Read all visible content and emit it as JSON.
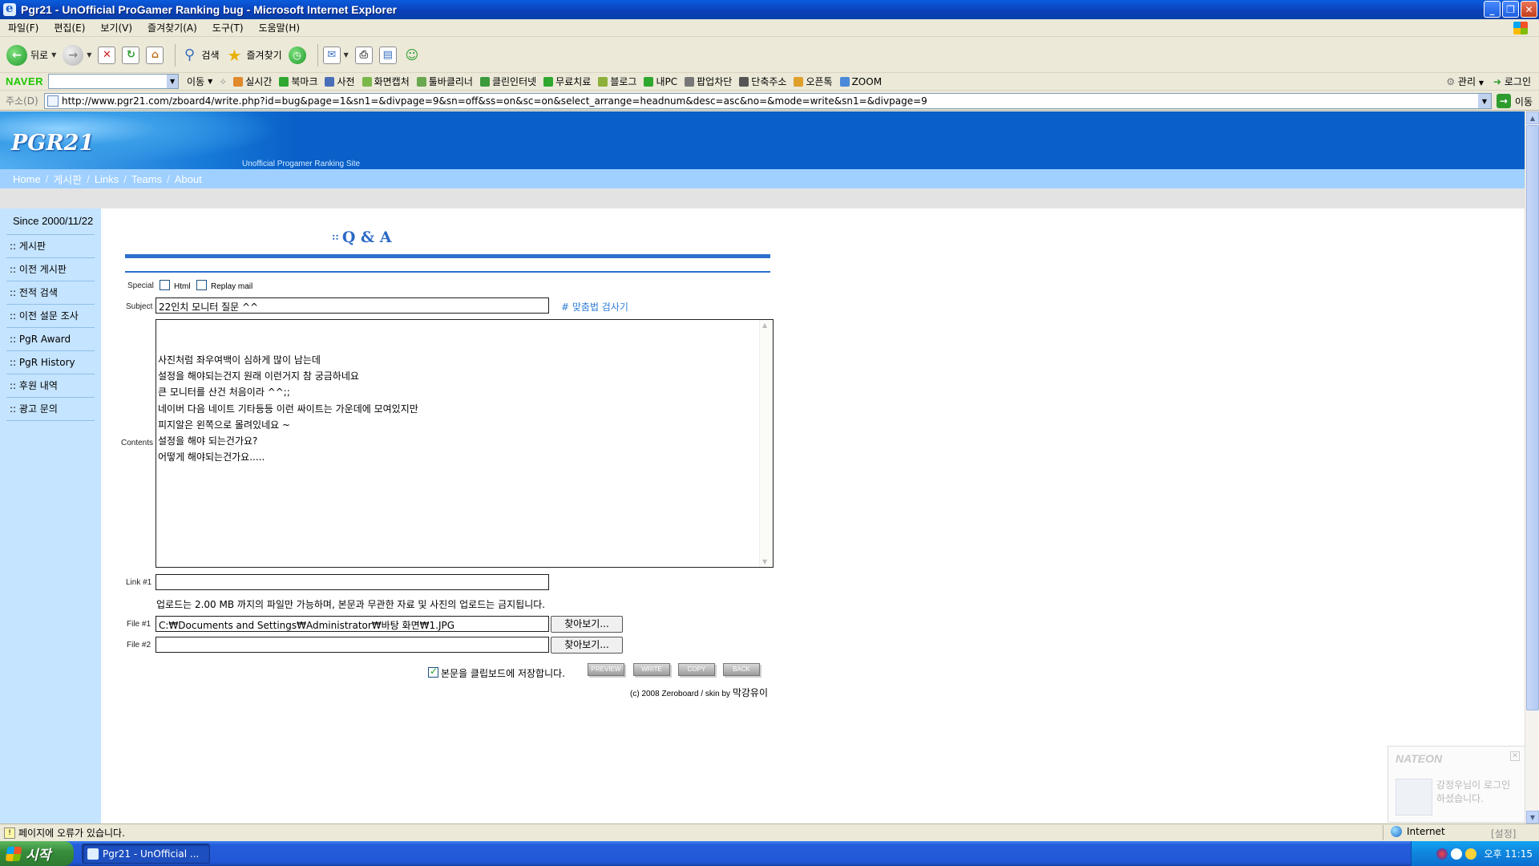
{
  "window": {
    "title": "Pgr21 - UnOfficial ProGamer Ranking bug - Microsoft Internet Explorer",
    "controls": [
      "_",
      "❐",
      "✕"
    ]
  },
  "menubar": [
    "파일(F)",
    "편집(E)",
    "보기(V)",
    "즐겨찾기(A)",
    "도구(T)",
    "도움말(H)"
  ],
  "toolbar": {
    "back": "뒤로",
    "search": "검색",
    "favorites": "즐겨찾기"
  },
  "naver_bar": {
    "logo": "NAVER",
    "search_value": "",
    "go": "이동",
    "items": [
      {
        "label": "실시간",
        "icon": "realtime-icon",
        "color": "#e08a2c"
      },
      {
        "label": "북마크",
        "icon": "star-icon",
        "color": "#2fa82f"
      },
      {
        "label": "사전",
        "icon": "dictionary-icon",
        "color": "#4a6fb8"
      },
      {
        "label": "화면캡처",
        "icon": "capture-icon",
        "color": "#7ab84a"
      },
      {
        "label": "툴바클리너",
        "icon": "cleaner-icon",
        "color": "#6aa84f"
      },
      {
        "label": "클린인터넷",
        "icon": "shield-icon",
        "color": "#3b9a3b"
      },
      {
        "label": "무료치료",
        "icon": "plus-icon",
        "color": "#2fa82f"
      },
      {
        "label": "블로그",
        "icon": "blog-icon",
        "color": "#8db03a"
      },
      {
        "label": "내PC",
        "icon": "pc-icon",
        "color": "#2fa82f"
      },
      {
        "label": "팝업차단",
        "icon": "popup-icon",
        "color": "#777777"
      },
      {
        "label": "단축주소",
        "icon": "shortcut-icon",
        "color": "#555555"
      },
      {
        "label": "오픈톡",
        "icon": "talk-icon",
        "color": "#e0a02c"
      },
      {
        "label": "ZOOM",
        "icon": "zoom-icon",
        "color": "#4a8ad8"
      }
    ],
    "right": [
      "관리",
      "로그인"
    ]
  },
  "address": {
    "label": "주소(D)",
    "url": "http://www.pgr21.com/zboard4/write.php?id=bug&page=1&sn1=&divpage=9&sn=off&ss=on&sc=on&select_arrange=headnum&desc=asc&no=&mode=write&sn1=&divpage=9",
    "go": "이동"
  },
  "site": {
    "logo": "PGR21",
    "subtitle": "Unofficial Progamer Ranking Site",
    "nav": [
      "Home",
      "게시판",
      "Links",
      "Teams",
      "About"
    ],
    "since": "Since 2000/11/22",
    "sidebar": [
      ":: 게시판",
      ":: 이전 게시판",
      ":: 전적 검색",
      ":: 이전 설문 조사",
      ":: PgR Award",
      ":: PgR History",
      ":: 후원 내역",
      ":: 광고 문의"
    ]
  },
  "form": {
    "board_title_prefix": "::",
    "board_title": "Q & A",
    "special_label": "Special",
    "html_label": "Html",
    "replay_mail_label": "Replay mail",
    "subject_label": "Subject",
    "subject_value": "22인치 모니터 질문 ^^",
    "spellcheck": "# 맞춤법 검사기",
    "contents_label": "Contents",
    "contents_value": "사진처럼 좌우여백이 심하게 많이 남는데\n설정을 해야되는건지 원래 이런거지 참 궁금하네요\n큰 모니터를 산건 처음이라 ^^;;\n네이버 다음 네이트 기타등등 이런 싸이트는 가운데에 모여있지만\n피지알은 왼쪽으로 몰려있네요 ~\n설정을 해야 되는건가요?\n어떻게 해야되는건가요.....",
    "link1_label": "Link #1",
    "link1_value": "",
    "upload_notice": "업로드는 2.00 MB 까지의 파일만 가능하며, 본문과 무관한 자료 및 사진의 업로드는 금지됩니다.",
    "file1_label": "File #1",
    "file1_value": "C:₩Documents and Settings₩Administrator₩바탕 화면₩1.JPG",
    "file2_label": "File #2",
    "file2_value": "",
    "browse": "찾아보기...",
    "clipboard_label": "본문을 클립보드에 저장합니다.",
    "buttons": [
      "PREVIEW",
      "WRITE",
      "COPY",
      "BACK"
    ],
    "copyright_prefix": "(c) 2008 Zeroboard / skin by",
    "copyright_author": "막강유이"
  },
  "nateon": {
    "logo": "NATEON",
    "message": "강정우님이 로그인 하셨습니다."
  },
  "statusbar": {
    "text": "페이지에 오류가 있습니다.",
    "zone": "Internet",
    "setting": "[설정]"
  },
  "taskbar": {
    "start": "시작",
    "task": "Pgr21 - UnOfficial ...",
    "clock": "오후 11:15"
  }
}
